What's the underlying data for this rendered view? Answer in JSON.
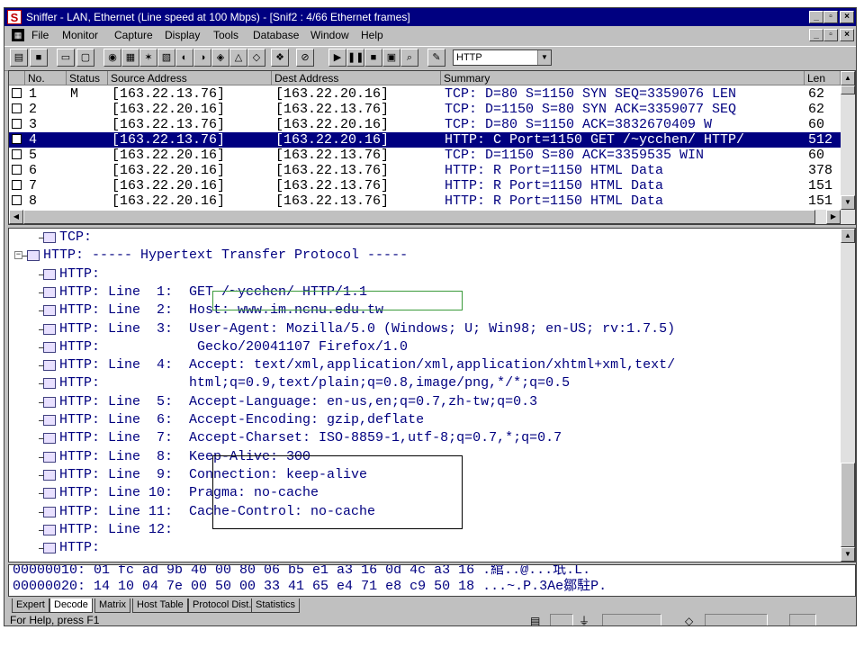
{
  "window": {
    "title": "Sniffer - LAN, Ethernet (Line speed at 100 Mbps) - [Snif2 : 4/66 Ethernet frames]",
    "app_icon": "S",
    "controls": {
      "minimize": "_",
      "maximize": "▫",
      "close": "×"
    },
    "mdi_controls": {
      "minimize": "_",
      "maximize": "▫",
      "close": "×"
    }
  },
  "menu": [
    "File",
    "Monitor",
    "Capture",
    "Display",
    "Tools",
    "Database",
    "Window",
    "Help"
  ],
  "toolbar": {
    "filter_value": "HTTP"
  },
  "packet_list": {
    "columns": [
      "No.",
      "Status",
      "Source Address",
      "Dest Address",
      "Summary",
      "Len"
    ],
    "rows": [
      {
        "no": "1",
        "status": "M",
        "src": "[163.22.13.76]",
        "dst": "[163.22.20.16]",
        "summary": "TCP: D=80 S=1150 SYN SEQ=3359076 LEN",
        "len": "62"
      },
      {
        "no": "2",
        "status": "",
        "src": "[163.22.20.16]",
        "dst": "[163.22.13.76]",
        "summary": "TCP: D=1150 S=80 SYN ACK=3359077 SEQ",
        "len": "62"
      },
      {
        "no": "3",
        "status": "",
        "src": "[163.22.13.76]",
        "dst": "[163.22.20.16]",
        "summary": "TCP: D=80 S=1150     ACK=3832670409 W",
        "len": "60"
      },
      {
        "no": "4",
        "status": "",
        "src": "[163.22.13.76]",
        "dst": "[163.22.20.16]",
        "summary": "HTTP: C Port=1150 GET /~ycchen/ HTTP/",
        "len": "512"
      },
      {
        "no": "5",
        "status": "",
        "src": "[163.22.20.16]",
        "dst": "[163.22.13.76]",
        "summary": "TCP: D=1150 S=80     ACK=3359535 WIN",
        "len": "60"
      },
      {
        "no": "6",
        "status": "",
        "src": "[163.22.20.16]",
        "dst": "[163.22.13.76]",
        "summary": "HTTP: R Port=1150 HTML Data",
        "len": "378"
      },
      {
        "no": "7",
        "status": "",
        "src": "[163.22.20.16]",
        "dst": "[163.22.13.76]",
        "summary": "HTTP: R Port=1150 HTML Data",
        "len": "151"
      },
      {
        "no": "8",
        "status": "",
        "src": "[163.22.20.16]",
        "dst": "[163.22.13.76]",
        "summary": "HTTP: R Port=1150 HTML Data",
        "len": "151"
      }
    ],
    "selected_index": 3
  },
  "detail": {
    "lines": [
      "TCP:",
      "HTTP: ----- Hypertext Transfer Protocol -----",
      "HTTP:",
      "HTTP: Line  1:  GET /~ycchen/ HTTP/1.1",
      "HTTP: Line  2:  Host: www.im.ncnu.edu.tw",
      "HTTP: Line  3:  User-Agent: Mozilla/5.0 (Windows; U; Win98; en-US; rv:1.7.5)",
      "HTTP:            Gecko/20041107 Firefox/1.0",
      "HTTP: Line  4:  Accept: text/xml,application/xml,application/xhtml+xml,text/",
      "HTTP:           html;q=0.9,text/plain;q=0.8,image/png,*/*;q=0.5",
      "HTTP: Line  5:  Accept-Language: en-us,en;q=0.7,zh-tw;q=0.3",
      "HTTP: Line  6:  Accept-Encoding: gzip,deflate",
      "HTTP: Line  7:  Accept-Charset: ISO-8859-1,utf-8;q=0.7,*;q=0.7",
      "HTTP: Line  8:  Keep-Alive: 300",
      "HTTP: Line  9:  Connection: keep-alive",
      "HTTP: Line 10:  Pragma: no-cache",
      "HTTP: Line 11:  Cache-Control: no-cache",
      "HTTP: Line 12:",
      "HTTP:"
    ]
  },
  "hex": {
    "line1": "00000010: 01 fc ad 9b 40 00 80 06 b5 e1 a3 16 0d 4c a3 16 .綰..@...坁.L.",
    "line2": "00000020: 14 10 04 7e 00 50 00 33 41 65 e4 71 e8 c9 50 18 ...~.P.3Ae鄒駐P."
  },
  "tabs": [
    "Expert",
    "Decode",
    "Matrix",
    "Host Table",
    "Protocol Dist.",
    "Statistics"
  ],
  "active_tab": "Decode",
  "status": {
    "message": "For Help, press F1"
  }
}
